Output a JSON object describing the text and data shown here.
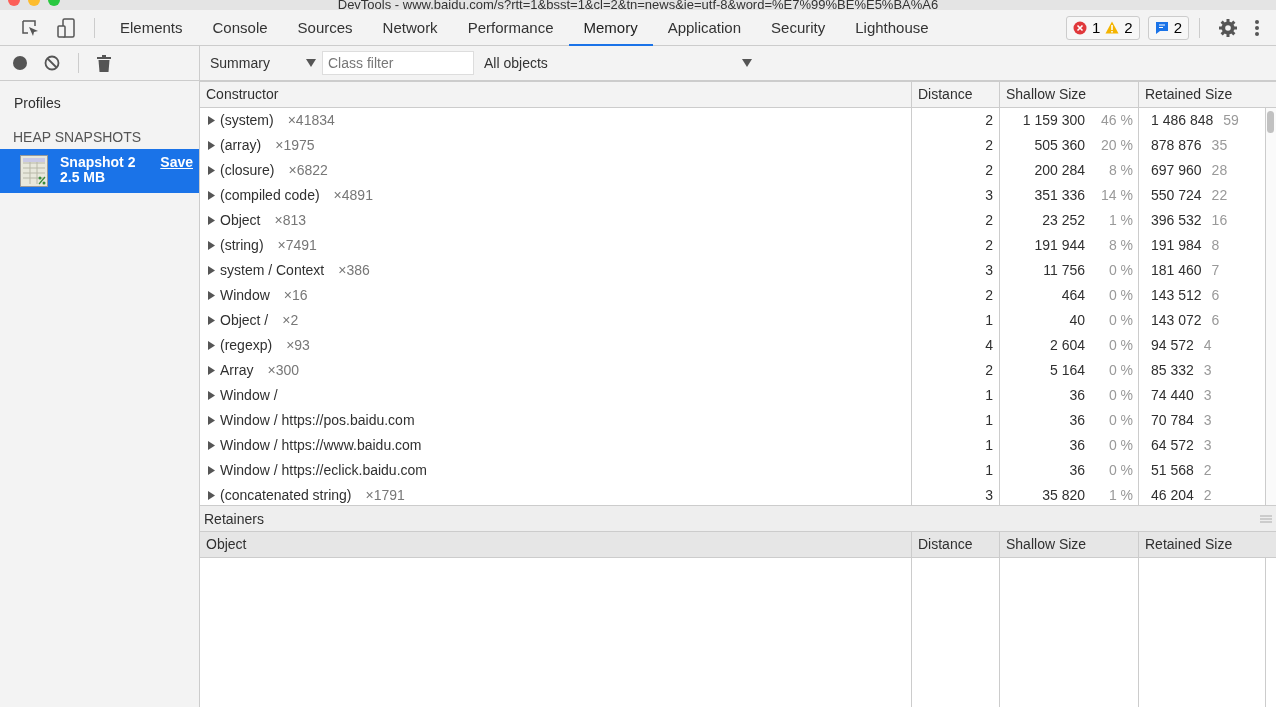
{
  "window": {
    "title": "DevTools - www.baidu.com/s?rtt=1&bsst=1&cl=2&tn=news&ie=utf-8&word=%E7%99%BE%E5%BA%A6"
  },
  "tabs": [
    {
      "label": "Elements",
      "selected": false
    },
    {
      "label": "Console",
      "selected": false
    },
    {
      "label": "Sources",
      "selected": false
    },
    {
      "label": "Network",
      "selected": false
    },
    {
      "label": "Performance",
      "selected": false
    },
    {
      "label": "Memory",
      "selected": true
    },
    {
      "label": "Application",
      "selected": false
    },
    {
      "label": "Security",
      "selected": false
    },
    {
      "label": "Lighthouse",
      "selected": false
    }
  ],
  "counters": {
    "errors": "1",
    "warnings": "2",
    "messages": "2"
  },
  "toolbar": {
    "view": "Summary",
    "filter_placeholder": "Class filter",
    "scope": "All objects"
  },
  "sidebar": {
    "heading": "Profiles",
    "section": "HEAP SNAPSHOTS",
    "snapshots": [
      {
        "name": "Snapshot 2",
        "size": "2.5 MB",
        "action": "Save",
        "selected": true
      }
    ]
  },
  "table": {
    "columns": [
      "Constructor",
      "Distance",
      "Shallow Size",
      "Retained Size"
    ],
    "rows": [
      {
        "name": "(system)",
        "count": "×41834",
        "distance": "2",
        "shallow": "1 159 300",
        "shallow_pct": "46 %",
        "retained": "1 486 848",
        "retained_pct": "59"
      },
      {
        "name": "(array)",
        "count": "×1975",
        "distance": "2",
        "shallow": "505 360",
        "shallow_pct": "20 %",
        "retained": "878 876",
        "retained_pct": "35"
      },
      {
        "name": "(closure)",
        "count": "×6822",
        "distance": "2",
        "shallow": "200 284",
        "shallow_pct": "8 %",
        "retained": "697 960",
        "retained_pct": "28"
      },
      {
        "name": "(compiled code)",
        "count": "×4891",
        "distance": "3",
        "shallow": "351 336",
        "shallow_pct": "14 %",
        "retained": "550 724",
        "retained_pct": "22"
      },
      {
        "name": "Object",
        "count": "×813",
        "distance": "2",
        "shallow": "23 252",
        "shallow_pct": "1 %",
        "retained": "396 532",
        "retained_pct": "16"
      },
      {
        "name": "(string)",
        "count": "×7491",
        "distance": "2",
        "shallow": "191 944",
        "shallow_pct": "8 %",
        "retained": "191 984",
        "retained_pct": "8"
      },
      {
        "name": "system / Context",
        "count": "×386",
        "distance": "3",
        "shallow": "11 756",
        "shallow_pct": "0 %",
        "retained": "181 460",
        "retained_pct": "7"
      },
      {
        "name": "Window",
        "count": "×16",
        "distance": "2",
        "shallow": "464",
        "shallow_pct": "0 %",
        "retained": "143 512",
        "retained_pct": "6"
      },
      {
        "name": "Object /",
        "count": "×2",
        "distance": "1",
        "shallow": "40",
        "shallow_pct": "0 %",
        "retained": "143 072",
        "retained_pct": "6"
      },
      {
        "name": "(regexp)",
        "count": "×93",
        "distance": "4",
        "shallow": "2 604",
        "shallow_pct": "0 %",
        "retained": "94 572",
        "retained_pct": "4"
      },
      {
        "name": "Array",
        "count": "×300",
        "distance": "2",
        "shallow": "5 164",
        "shallow_pct": "0 %",
        "retained": "85 332",
        "retained_pct": "3"
      },
      {
        "name": "Window /",
        "distance": "1",
        "shallow": "36",
        "shallow_pct": "0 %",
        "retained": "74 440",
        "retained_pct": "3"
      },
      {
        "name": "Window / https://pos.baidu.com",
        "distance": "1",
        "shallow": "36",
        "shallow_pct": "0 %",
        "retained": "70 784",
        "retained_pct": "3"
      },
      {
        "name": "Window / https://www.baidu.com",
        "distance": "1",
        "shallow": "36",
        "shallow_pct": "0 %",
        "retained": "64 572",
        "retained_pct": "3"
      },
      {
        "name": "Window / https://eclick.baidu.com",
        "distance": "1",
        "shallow": "36",
        "shallow_pct": "0 %",
        "retained": "51 568",
        "retained_pct": "2"
      },
      {
        "name": "(concatenated string)",
        "count": "×1791",
        "distance": "3",
        "shallow": "35 820",
        "shallow_pct": "1 %",
        "retained": "46 204",
        "retained_pct": "2"
      }
    ]
  },
  "retainers": {
    "title": "Retainers",
    "columns": [
      "Object",
      "Distance",
      "Shallow Size",
      "Retained Size"
    ]
  }
}
